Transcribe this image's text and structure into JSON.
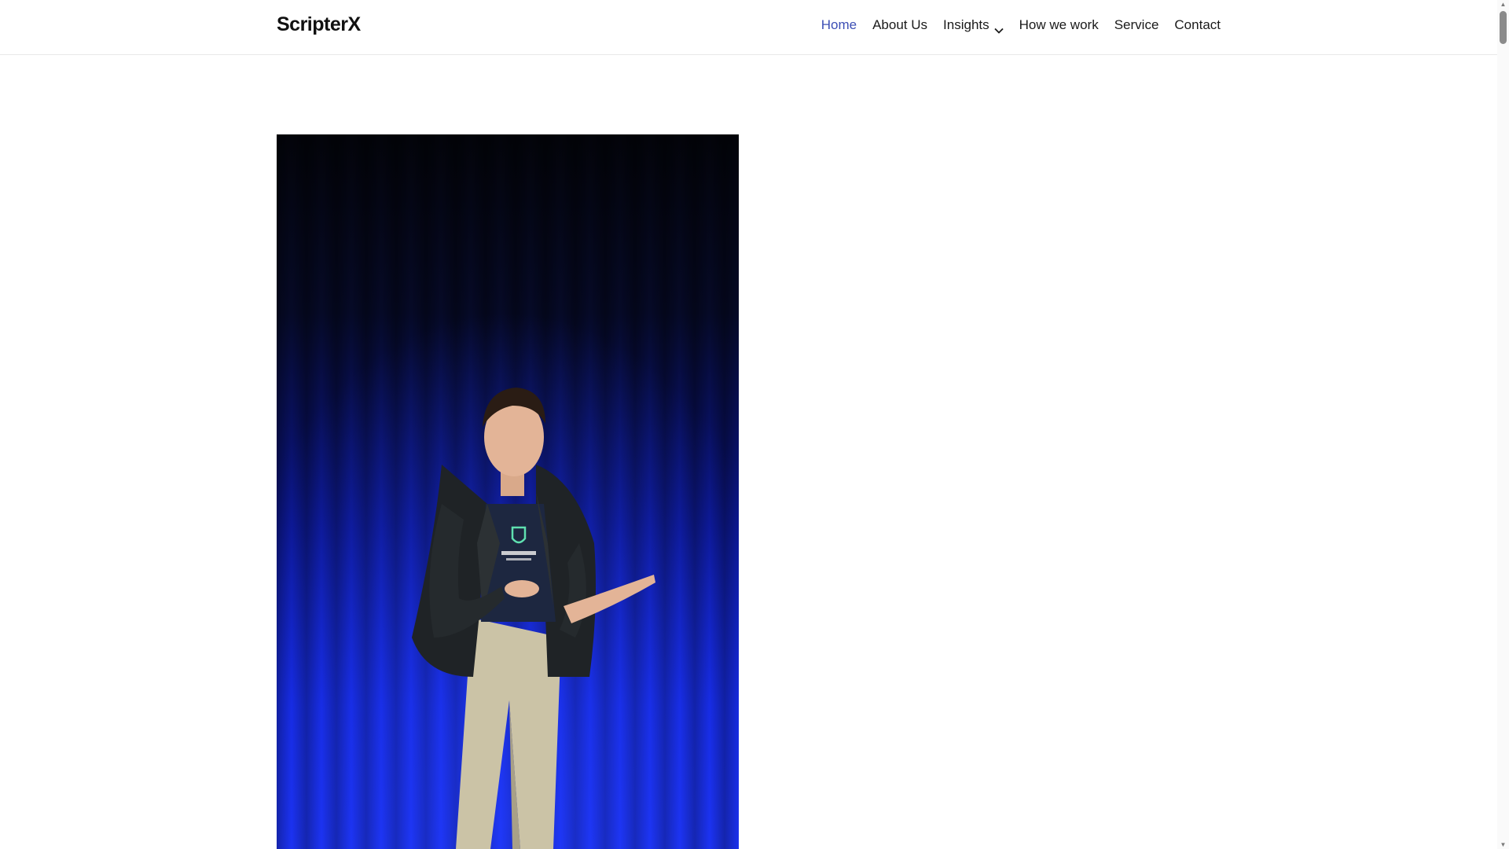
{
  "header": {
    "brand": "ScripterX",
    "nav": [
      {
        "label": "Home",
        "active": true
      },
      {
        "label": "About Us",
        "active": false
      },
      {
        "label": "Insights",
        "active": false,
        "has_dropdown": true
      },
      {
        "label": "How we work",
        "active": false
      },
      {
        "label": "Service",
        "active": false
      },
      {
        "label": "Contact",
        "active": false
      }
    ]
  },
  "hero": {
    "image_subject": "speaker on stage in front of blue curtain"
  },
  "colors": {
    "active_nav": "#3d4fb5",
    "text": "#1a1a1a",
    "curtain_blue": "#1a2ce0"
  },
  "icons": {
    "dropdown": "chevron-down-icon",
    "scroll_up": "arrow-up-icon",
    "scroll_down": "arrow-down-icon"
  }
}
